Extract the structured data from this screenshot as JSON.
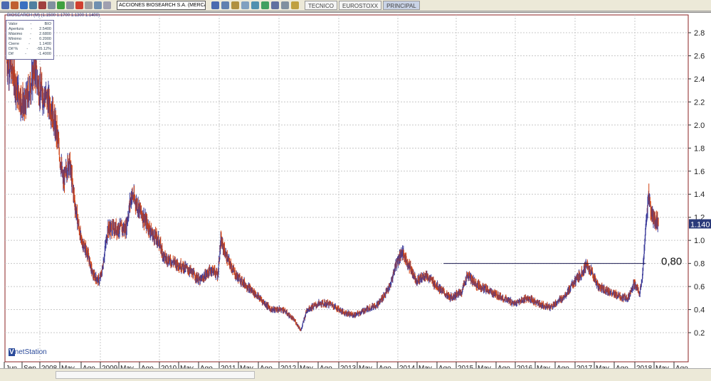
{
  "toolbar": {
    "symbol": "ACCIONES BIOSEARCH S.A. (MERCADO CO",
    "tabs": [
      "TECNICO",
      "EUROSTOXX",
      "PRINCIPAL"
    ],
    "active_tab": "PRINCIPAL"
  },
  "chart_title": "BIOSEARCH (M) (1.1500 1.1700 1.1300 1.1400)",
  "info": [
    [
      "Valor",
      "-",
      "BIO"
    ],
    [
      "Apertura",
      "-",
      "2.5400"
    ],
    [
      "Máximo",
      "-",
      "2.6800"
    ],
    [
      "Mínimo",
      "-",
      "0.2000"
    ],
    [
      "Cierre",
      "-",
      "1.1400"
    ],
    [
      "Dif %",
      "-",
      "-55.12%"
    ],
    [
      "Dif",
      "-",
      "-1.4000"
    ]
  ],
  "logo": "netStation",
  "chart_data": {
    "type": "bar",
    "ylim": [
      0,
      2.9
    ],
    "yticks": [
      "0.2",
      "0.4",
      "0.6",
      "0.8",
      "1.0",
      "1.2",
      "1.4",
      "1.6",
      "1.8",
      "2.0",
      "2.2",
      "2.4",
      "2.6",
      "2.8"
    ],
    "xticks": [
      "Jun",
      "Sep",
      "2008",
      "May",
      "Ago",
      "2009",
      "May",
      "Ago",
      "2010",
      "May",
      "Ago",
      "2011",
      "May",
      "Ago",
      "2012",
      "May",
      "Ago",
      "2013",
      "May",
      "Ago",
      "2014",
      "May",
      "Ago",
      "2015",
      "May",
      "Ago",
      "2016",
      "May",
      "Ago",
      "2017",
      "May",
      "Ago",
      "2018",
      "May",
      "Ago"
    ],
    "last_price": "1.140",
    "hline": {
      "value": 0.8,
      "label": "0,80",
      "from": 2014.8,
      "to": 2018.2
    },
    "colors": {
      "up": "#3a3a9a",
      "down": "#d04010",
      "grid": "#c8c8c8"
    },
    "points": [
      [
        2007.45,
        2.55
      ],
      [
        2007.55,
        2.45
      ],
      [
        2007.62,
        2.3
      ],
      [
        2007.75,
        2.15
      ],
      [
        2007.85,
        2.35
      ],
      [
        2007.92,
        2.5
      ],
      [
        2008.0,
        2.3
      ],
      [
        2008.1,
        2.25
      ],
      [
        2008.2,
        2.15
      ],
      [
        2008.3,
        1.9
      ],
      [
        2008.4,
        1.5
      ],
      [
        2008.5,
        1.7
      ],
      [
        2008.6,
        1.3
      ],
      [
        2008.7,
        1.0
      ],
      [
        2008.8,
        0.9
      ],
      [
        2008.9,
        0.7
      ],
      [
        2009.0,
        0.65
      ],
      [
        2009.05,
        0.72
      ],
      [
        2009.15,
        1.1
      ],
      [
        2009.3,
        1.1
      ],
      [
        2009.45,
        1.1
      ],
      [
        2009.55,
        1.4
      ],
      [
        2009.65,
        1.3
      ],
      [
        2009.75,
        1.2
      ],
      [
        2009.9,
        1.05
      ],
      [
        2010.0,
        1.0
      ],
      [
        2010.1,
        0.85
      ],
      [
        2010.3,
        0.8
      ],
      [
        2010.5,
        0.75
      ],
      [
        2010.7,
        0.65
      ],
      [
        2010.9,
        0.75
      ],
      [
        2011.0,
        0.7
      ],
      [
        2011.05,
        1.0
      ],
      [
        2011.15,
        0.85
      ],
      [
        2011.3,
        0.7
      ],
      [
        2011.5,
        0.6
      ],
      [
        2011.7,
        0.5
      ],
      [
        2011.9,
        0.4
      ],
      [
        2012.1,
        0.4
      ],
      [
        2012.3,
        0.3
      ],
      [
        2012.4,
        0.22
      ],
      [
        2012.5,
        0.4
      ],
      [
        2012.7,
        0.45
      ],
      [
        2012.9,
        0.45
      ],
      [
        2013.1,
        0.38
      ],
      [
        2013.3,
        0.35
      ],
      [
        2013.5,
        0.4
      ],
      [
        2013.7,
        0.45
      ],
      [
        2013.9,
        0.6
      ],
      [
        2014.0,
        0.8
      ],
      [
        2014.1,
        0.9
      ],
      [
        2014.2,
        0.8
      ],
      [
        2014.35,
        0.65
      ],
      [
        2014.5,
        0.7
      ],
      [
        2014.7,
        0.6
      ],
      [
        2014.9,
        0.5
      ],
      [
        2015.1,
        0.55
      ],
      [
        2015.2,
        0.7
      ],
      [
        2015.35,
        0.62
      ],
      [
        2015.6,
        0.55
      ],
      [
        2015.8,
        0.5
      ],
      [
        2016.0,
        0.45
      ],
      [
        2016.2,
        0.5
      ],
      [
        2016.4,
        0.45
      ],
      [
        2016.6,
        0.42
      ],
      [
        2016.8,
        0.5
      ],
      [
        2016.95,
        0.6
      ],
      [
        2017.1,
        0.7
      ],
      [
        2017.2,
        0.78
      ],
      [
        2017.3,
        0.72
      ],
      [
        2017.4,
        0.6
      ],
      [
        2017.6,
        0.55
      ],
      [
        2017.8,
        0.5
      ],
      [
        2017.9,
        0.5
      ],
      [
        2018.0,
        0.62
      ],
      [
        2018.1,
        0.55
      ],
      [
        2018.15,
        0.7
      ],
      [
        2018.2,
        1.1
      ],
      [
        2018.25,
        1.4
      ],
      [
        2018.3,
        1.2
      ],
      [
        2018.4,
        1.15
      ],
      [
        2018.42,
        1.14
      ]
    ]
  }
}
